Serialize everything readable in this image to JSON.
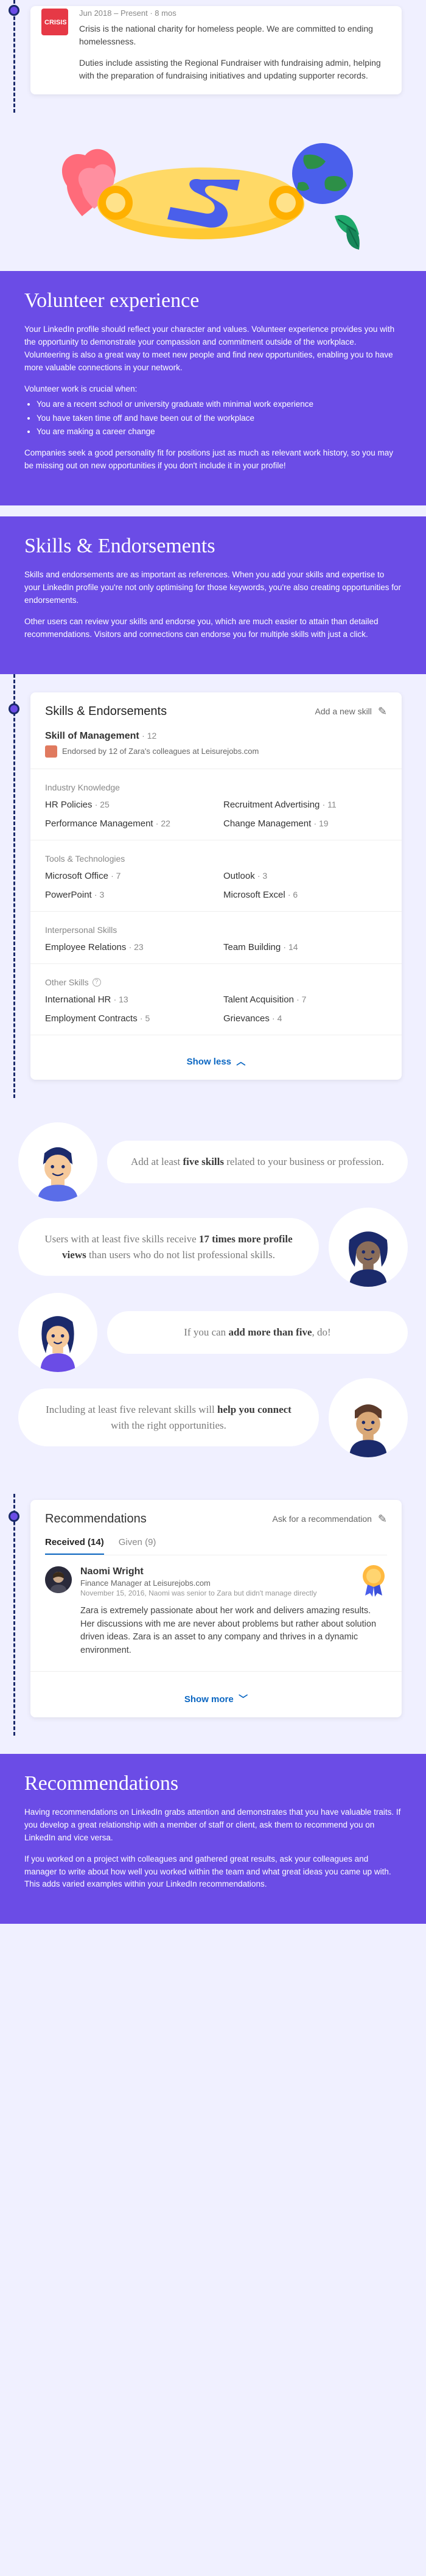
{
  "experience": {
    "logo_text": "CRISIS",
    "meta": "Jun 2018 – Present · 8 mos",
    "desc1": "Crisis is the national charity for homeless people. We are committed to ending homelessness.",
    "desc2": "Duties include assisting the Regional Fundraiser with fundraising admin, helping with the preparation of fundraising initiatives and updating supporter records."
  },
  "volunteer": {
    "heading": "Volunteer experience",
    "p1": "Your LinkedIn profile should reflect your character and values. Volunteer experience provides you with the opportunity to demonstrate your compassion and commitment outside of the workplace. Volunteering is also a great way to meet new people and find new opportunities, enabling you to have more valuable connections in your network.",
    "p2": "Volunteer work is crucial when:",
    "bullets": [
      "You are a recent school or university graduate with minimal work experience",
      "You have taken time off and have been out of the workplace",
      "You are making a career change"
    ],
    "p3": "Companies seek a good personality fit for positions just as much as relevant work history, so you may be missing out on new opportunities if you don't include it in your profile!"
  },
  "skillsEnd": {
    "heading": "Skills & Endorsements",
    "p1": "Skills and endorsements are as important as references. When you add your skills and expertise to your LinkedIn profile you're not only optimising for those keywords, you're also creating opportunities for endorsements.",
    "p2": "Other users can review your skills and endorse you, which are much easier to attain than detailed recommendations. Visitors and connections can endorse you for multiple skills with just a click."
  },
  "skillsCard": {
    "title": "Skills & Endorsements",
    "add": "Add a new skill",
    "topSkill": "Skill of Management",
    "topCount": "· 12",
    "endorsedBy": "Endorsed by 12 of Zara's colleagues at Leisurejobs.com",
    "cat1": "Industry Knowledge",
    "industry": [
      {
        "name": "HR Policies",
        "cnt": "· 25"
      },
      {
        "name": "Recruitment Advertising",
        "cnt": "· 11"
      },
      {
        "name": "Performance Management",
        "cnt": "· 22"
      },
      {
        "name": "Change Management",
        "cnt": "· 19"
      }
    ],
    "cat2": "Tools & Technologies",
    "tools": [
      {
        "name": "Microsoft Office",
        "cnt": "· 7"
      },
      {
        "name": "Outlook",
        "cnt": "· 3"
      },
      {
        "name": "PowerPoint",
        "cnt": "· 3"
      },
      {
        "name": "Microsoft Excel",
        "cnt": "· 6"
      }
    ],
    "cat3": "Interpersonal Skills",
    "interpersonal": [
      {
        "name": "Employee Relations",
        "cnt": "· 23"
      },
      {
        "name": "Team Building",
        "cnt": "· 14"
      }
    ],
    "cat4": "Other Skills",
    "other": [
      {
        "name": "International HR",
        "cnt": "· 13"
      },
      {
        "name": "Talent Acquisition",
        "cnt": "· 7"
      },
      {
        "name": "Employment Contracts",
        "cnt": "· 5"
      },
      {
        "name": "Grievances",
        "cnt": "· 4"
      }
    ],
    "showless": "Show less"
  },
  "speech": {
    "s1a": "Add at least ",
    "s1b": "five skills",
    "s1c": " related to your business or profession.",
    "s2a": "Users with at least five skills receive ",
    "s2b": "17 times more profile views",
    "s2c": " than users who do not list professional skills.",
    "s3a": "If you can ",
    "s3b": "add more than five",
    "s3c": ", do!",
    "s4a": "Including at least five relevant skills will ",
    "s4b": "help you connect",
    "s4c": " with the right opportunities."
  },
  "recCard": {
    "title": "Recommendations",
    "ask": "Ask for a recommendation",
    "tab1": "Received (14)",
    "tab2": "Given (9)",
    "name": "Naomi Wright",
    "role": "Finance Manager at Leisurejobs.com",
    "date": "November 15, 2016, Naomi was senior to Zara but didn't manage directly",
    "body": "Zara is extremely passionate about her work and delivers amazing results. Her discussions with me are never about problems but rather about solution driven ideas. Zara is an asset to any company and thrives in a dynamic environment.",
    "showmore": "Show more"
  },
  "recSection": {
    "heading": "Recommendations",
    "p1": "Having recommendations on LinkedIn grabs attention and demonstrates that you have valuable traits. If you develop a great relationship with a member of staff or client, ask them to recommend you on LinkedIn and vice versa.",
    "p2": "If you worked on a project with colleagues and gathered great results, ask your colleagues and manager to write about how well you worked within the team and what great ideas you came up with. This adds varied examples within your LinkedIn recommendations."
  }
}
